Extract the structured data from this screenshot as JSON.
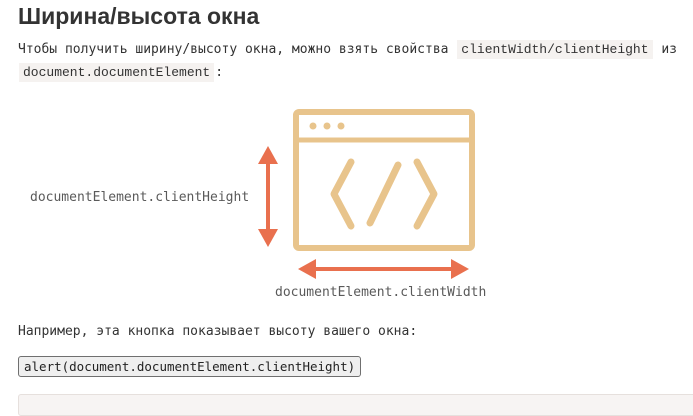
{
  "heading": "Ширина/высота окна",
  "intro": {
    "text_before": "Чтобы получить ширину/высоту окна, можно взять свойства",
    "code": "clientWidth/clientHeight",
    "text_middle": "из",
    "code2": "document.documentElement",
    "text_after": ":"
  },
  "diagram": {
    "height_label": "documentElement.clientHeight",
    "width_label": "documentElement.clientWidth",
    "window_icon": "browser-window-code-icon",
    "colors": {
      "window": "#e8c48c",
      "arrows": "#e9704e"
    }
  },
  "example": {
    "text": "Например, эта кнопка показывает высоту вашего окна:",
    "button_label": "alert(document.documentElement.clientHeight)"
  }
}
